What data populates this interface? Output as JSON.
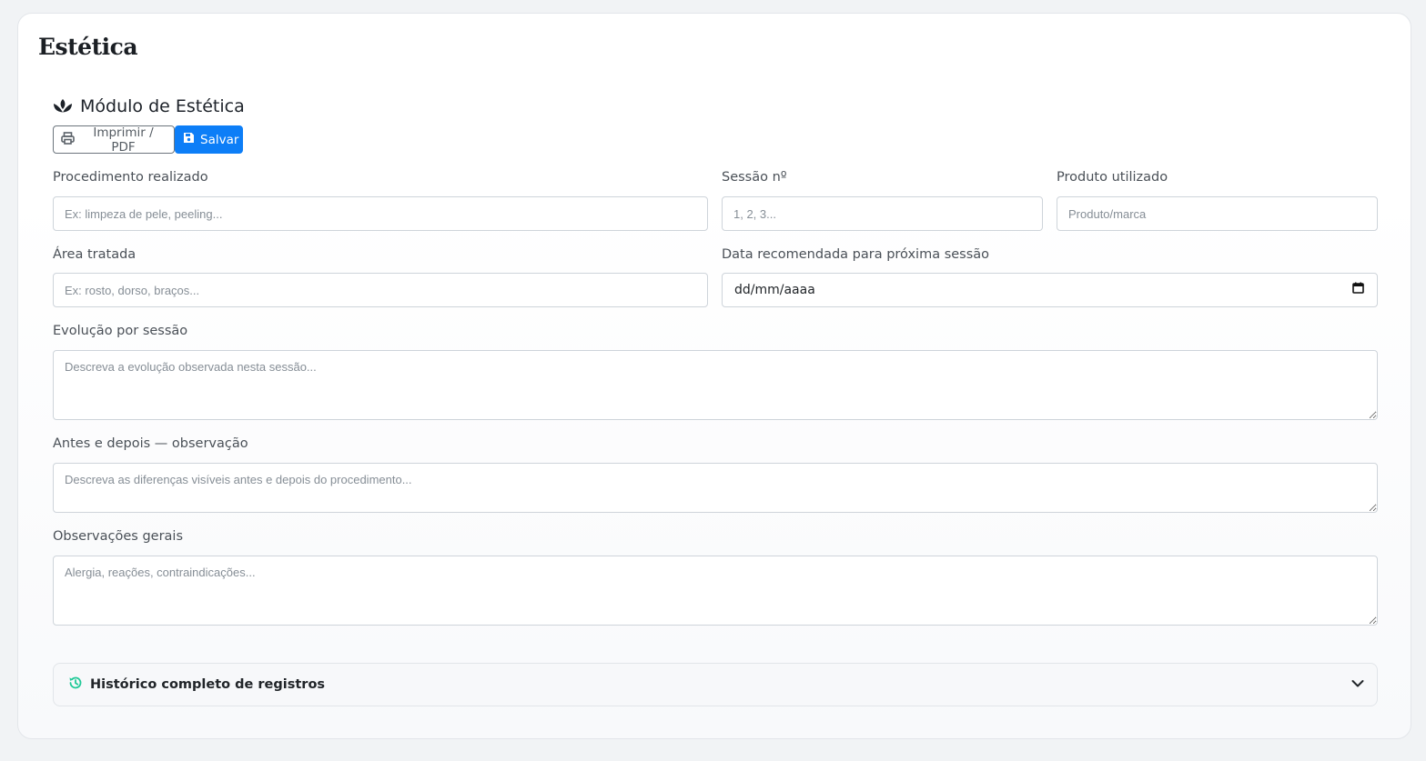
{
  "page": {
    "title": "Estética"
  },
  "module": {
    "icon": "spa-lotus-icon",
    "title": "Módulo de Estética"
  },
  "toolbar": {
    "print_label": "Imprimir / PDF",
    "print_icon": "printer-icon",
    "save_label": "Salvar",
    "save_icon": "floppy-disk-icon"
  },
  "form": {
    "procedimento": {
      "label": "Procedimento realizado",
      "placeholder": "Ex: limpeza de pele, peeling...",
      "value": ""
    },
    "sessao": {
      "label": "Sessão nº",
      "placeholder": "1, 2, 3...",
      "value": ""
    },
    "produto": {
      "label": "Produto utilizado",
      "placeholder": "Produto/marca",
      "value": ""
    },
    "area": {
      "label": "Área tratada",
      "placeholder": "Ex: rosto, dorso, braços...",
      "value": ""
    },
    "data_proxima": {
      "label": "Data recomendada para próxima sessão",
      "value_display": "dd/mm/aaaa",
      "icon": "calendar-icon"
    },
    "evolucao": {
      "label": "Evolução por sessão",
      "placeholder": "Descreva a evolução observada nesta sessão...",
      "value": ""
    },
    "antes_depois": {
      "label": "Antes e depois — observação",
      "placeholder": "Descreva as diferenças visíveis antes e depois do procedimento...",
      "value": ""
    },
    "observacoes": {
      "label": "Observações gerais",
      "placeholder": "Alergia, reações, contraindicações...",
      "value": ""
    }
  },
  "history": {
    "icon": "history-icon",
    "title": "Histórico completo de registros",
    "toggle_icon": "chevron-down-icon",
    "accent_color": "#20c997"
  },
  "colors": {
    "primary": "#0d7ef7",
    "text": "#212529",
    "muted_text": "#4a5057",
    "border": "#ced4da"
  }
}
